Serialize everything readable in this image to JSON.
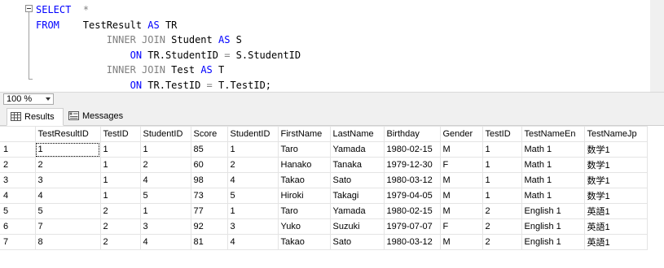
{
  "sql_lines": [
    [
      {
        "t": "SELECT",
        "c": "kw"
      },
      {
        "t": "  ",
        "c": "id"
      },
      {
        "t": "*",
        "c": "gr"
      }
    ],
    [
      {
        "t": "FROM",
        "c": "kw"
      },
      {
        "t": "    TestResult ",
        "c": "id"
      },
      {
        "t": "AS",
        "c": "kw"
      },
      {
        "t": " TR",
        "c": "id"
      }
    ],
    [
      {
        "t": "            ",
        "c": "id"
      },
      {
        "t": "INNER JOIN",
        "c": "gr"
      },
      {
        "t": " Student ",
        "c": "id"
      },
      {
        "t": "AS",
        "c": "kw"
      },
      {
        "t": " S",
        "c": "id"
      }
    ],
    [
      {
        "t": "                ",
        "c": "id"
      },
      {
        "t": "ON",
        "c": "kw"
      },
      {
        "t": " TR.StudentID ",
        "c": "id"
      },
      {
        "t": "=",
        "c": "gr"
      },
      {
        "t": " S.StudentID",
        "c": "id"
      }
    ],
    [
      {
        "t": "            ",
        "c": "id"
      },
      {
        "t": "INNER JOIN",
        "c": "gr"
      },
      {
        "t": " Test ",
        "c": "id"
      },
      {
        "t": "AS",
        "c": "kw"
      },
      {
        "t": " T",
        "c": "id"
      }
    ],
    [
      {
        "t": "                ",
        "c": "id"
      },
      {
        "t": "ON",
        "c": "kw"
      },
      {
        "t": " TR.TestID ",
        "c": "id"
      },
      {
        "t": "=",
        "c": "gr"
      },
      {
        "t": " T.TestID;",
        "c": "id"
      }
    ]
  ],
  "zoom": {
    "value": "100 %"
  },
  "tabs": {
    "results": "Results",
    "messages": "Messages"
  },
  "grid": {
    "columns": [
      "TestResultID",
      "TestID",
      "StudentID",
      "Score",
      "StudentID",
      "FirstName",
      "LastName",
      "Birthday",
      "Gender",
      "TestID",
      "TestNameEn",
      "TestNameJp"
    ],
    "rows": [
      [
        "1",
        "1",
        "1",
        "1",
        "85",
        "1",
        "Taro",
        "Yamada",
        "1980-02-15",
        "M",
        "1",
        "Math 1",
        "数学1"
      ],
      [
        "2",
        "2",
        "1",
        "2",
        "60",
        "2",
        "Hanako",
        "Tanaka",
        "1979-12-30",
        "F",
        "1",
        "Math 1",
        "数学1"
      ],
      [
        "3",
        "3",
        "1",
        "4",
        "98",
        "4",
        "Takao",
        "Sato",
        "1980-03-12",
        "M",
        "1",
        "Math 1",
        "数学1"
      ],
      [
        "4",
        "4",
        "1",
        "5",
        "73",
        "5",
        "Hiroki",
        "Takagi",
        "1979-04-05",
        "M",
        "1",
        "Math 1",
        "数学1"
      ],
      [
        "5",
        "5",
        "2",
        "1",
        "77",
        "1",
        "Taro",
        "Yamada",
        "1980-02-15",
        "M",
        "2",
        "English 1",
        "英語1"
      ],
      [
        "6",
        "7",
        "2",
        "3",
        "92",
        "3",
        "Yuko",
        "Suzuki",
        "1979-07-07",
        "F",
        "2",
        "English 1",
        "英語1"
      ],
      [
        "7",
        "8",
        "2",
        "4",
        "81",
        "4",
        "Takao",
        "Sato",
        "1980-03-12",
        "M",
        "2",
        "English 1",
        "英語1"
      ]
    ]
  }
}
